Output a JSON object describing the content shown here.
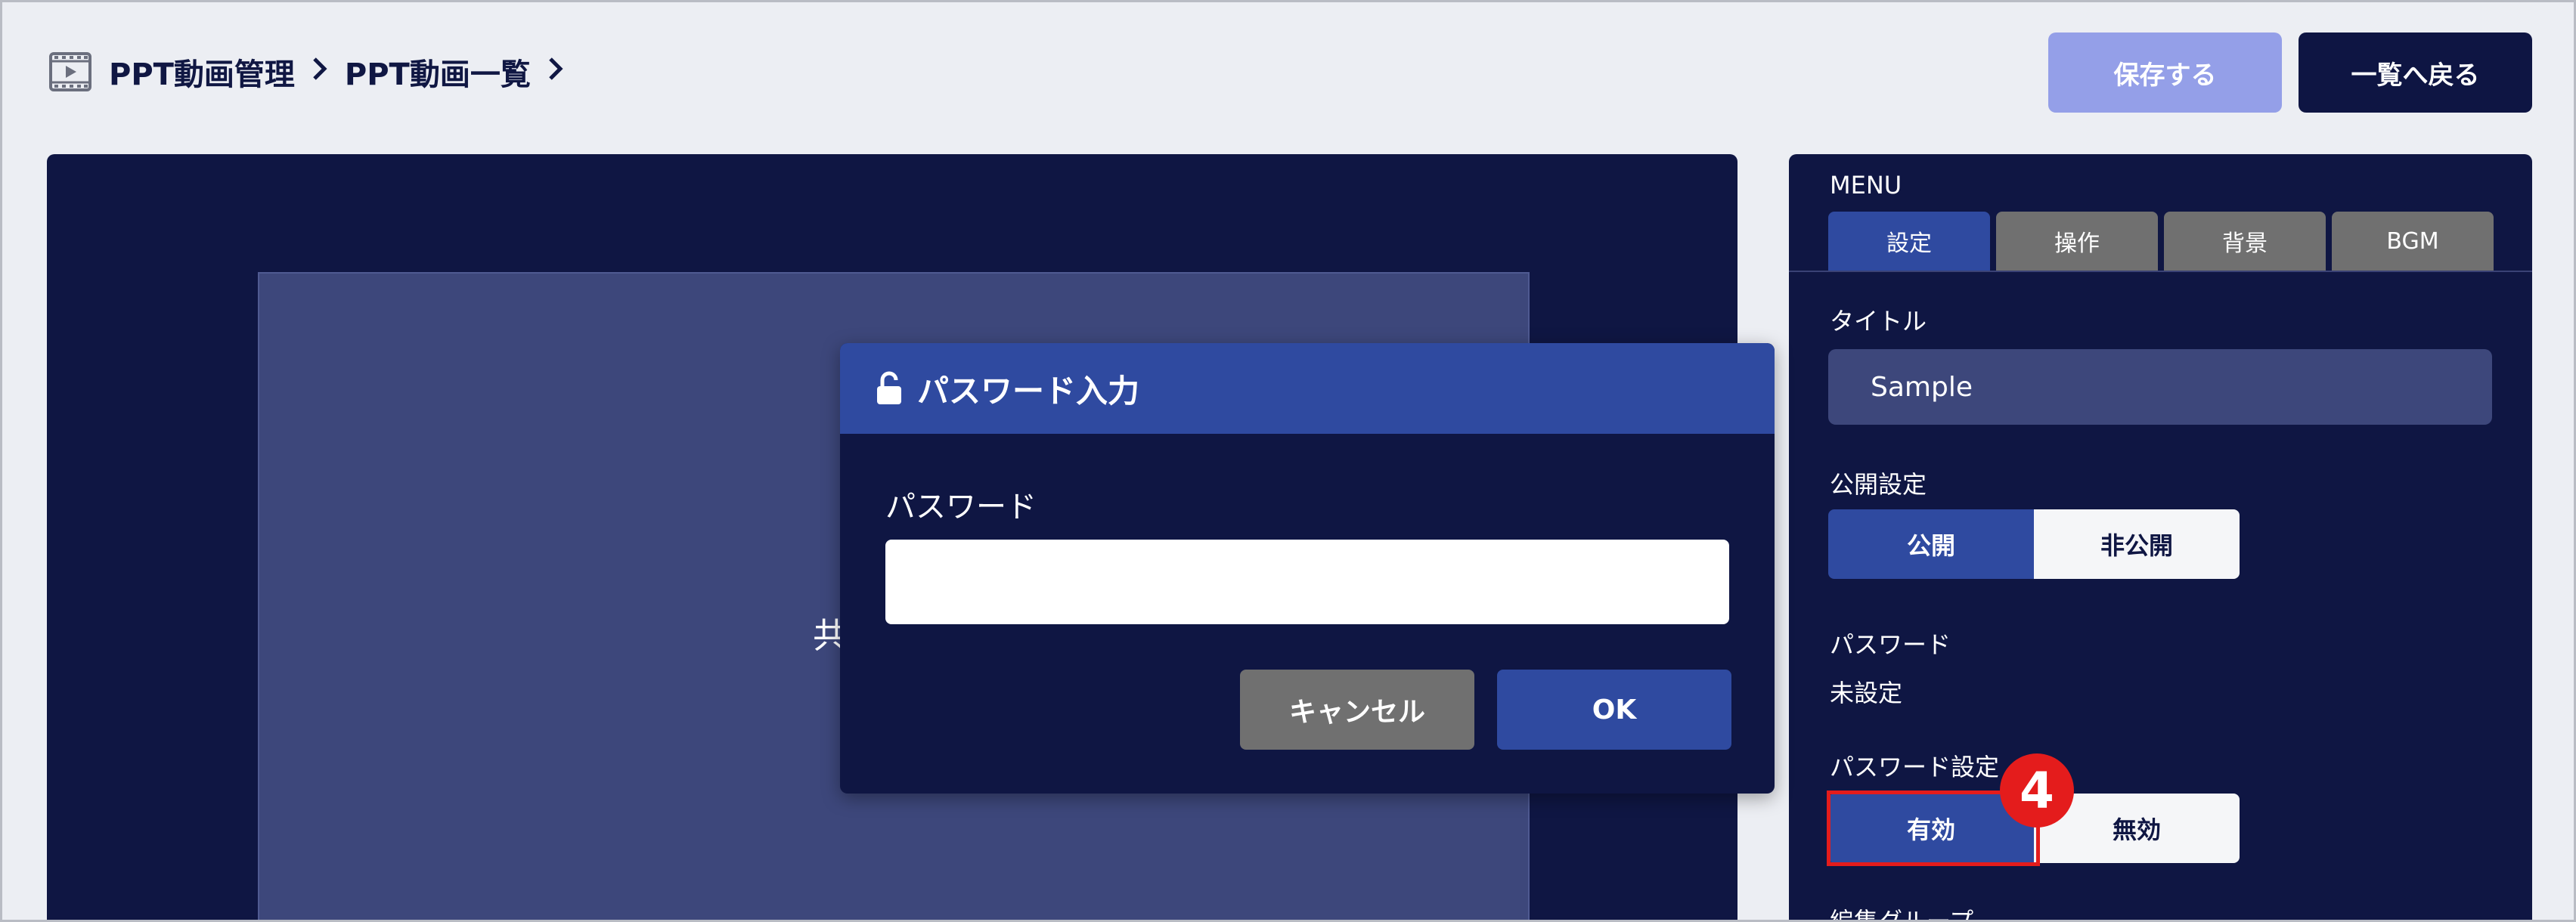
{
  "header": {
    "breadcrumb": [
      "PPT動画管理",
      "PPT動画一覧"
    ],
    "save_label": "保存する",
    "back_label": "一覧へ戻る"
  },
  "preview": {
    "partial_text": "共"
  },
  "menu": {
    "caption": "MENU",
    "tabs": [
      {
        "label": "設定",
        "active": true
      },
      {
        "label": "操作",
        "active": false
      },
      {
        "label": "背景",
        "active": false
      },
      {
        "label": "BGM",
        "active": false
      }
    ],
    "title_label": "タイトル",
    "title_value": "Sample",
    "publish_label": "公開設定",
    "publish_options": [
      "公開",
      "非公開"
    ],
    "publish_selected": "公開",
    "password_label": "パスワード",
    "password_value": "未設定",
    "password_setting_label": "パスワード設定",
    "password_setting_options": [
      "有効",
      "無効"
    ],
    "password_setting_selected": "有効",
    "cut_off_label": "編集グループ",
    "step_number": "4"
  },
  "modal": {
    "title": "パスワード入力",
    "field_label": "パスワード",
    "field_value": "",
    "cancel_label": "キャンセル",
    "ok_label": "OK"
  },
  "colors": {
    "navy": "#0f1643",
    "primary": "#2f4aa0",
    "disabled_save": "#949fe8",
    "gray_button": "#707070",
    "highlight_red": "#e41c1c"
  }
}
